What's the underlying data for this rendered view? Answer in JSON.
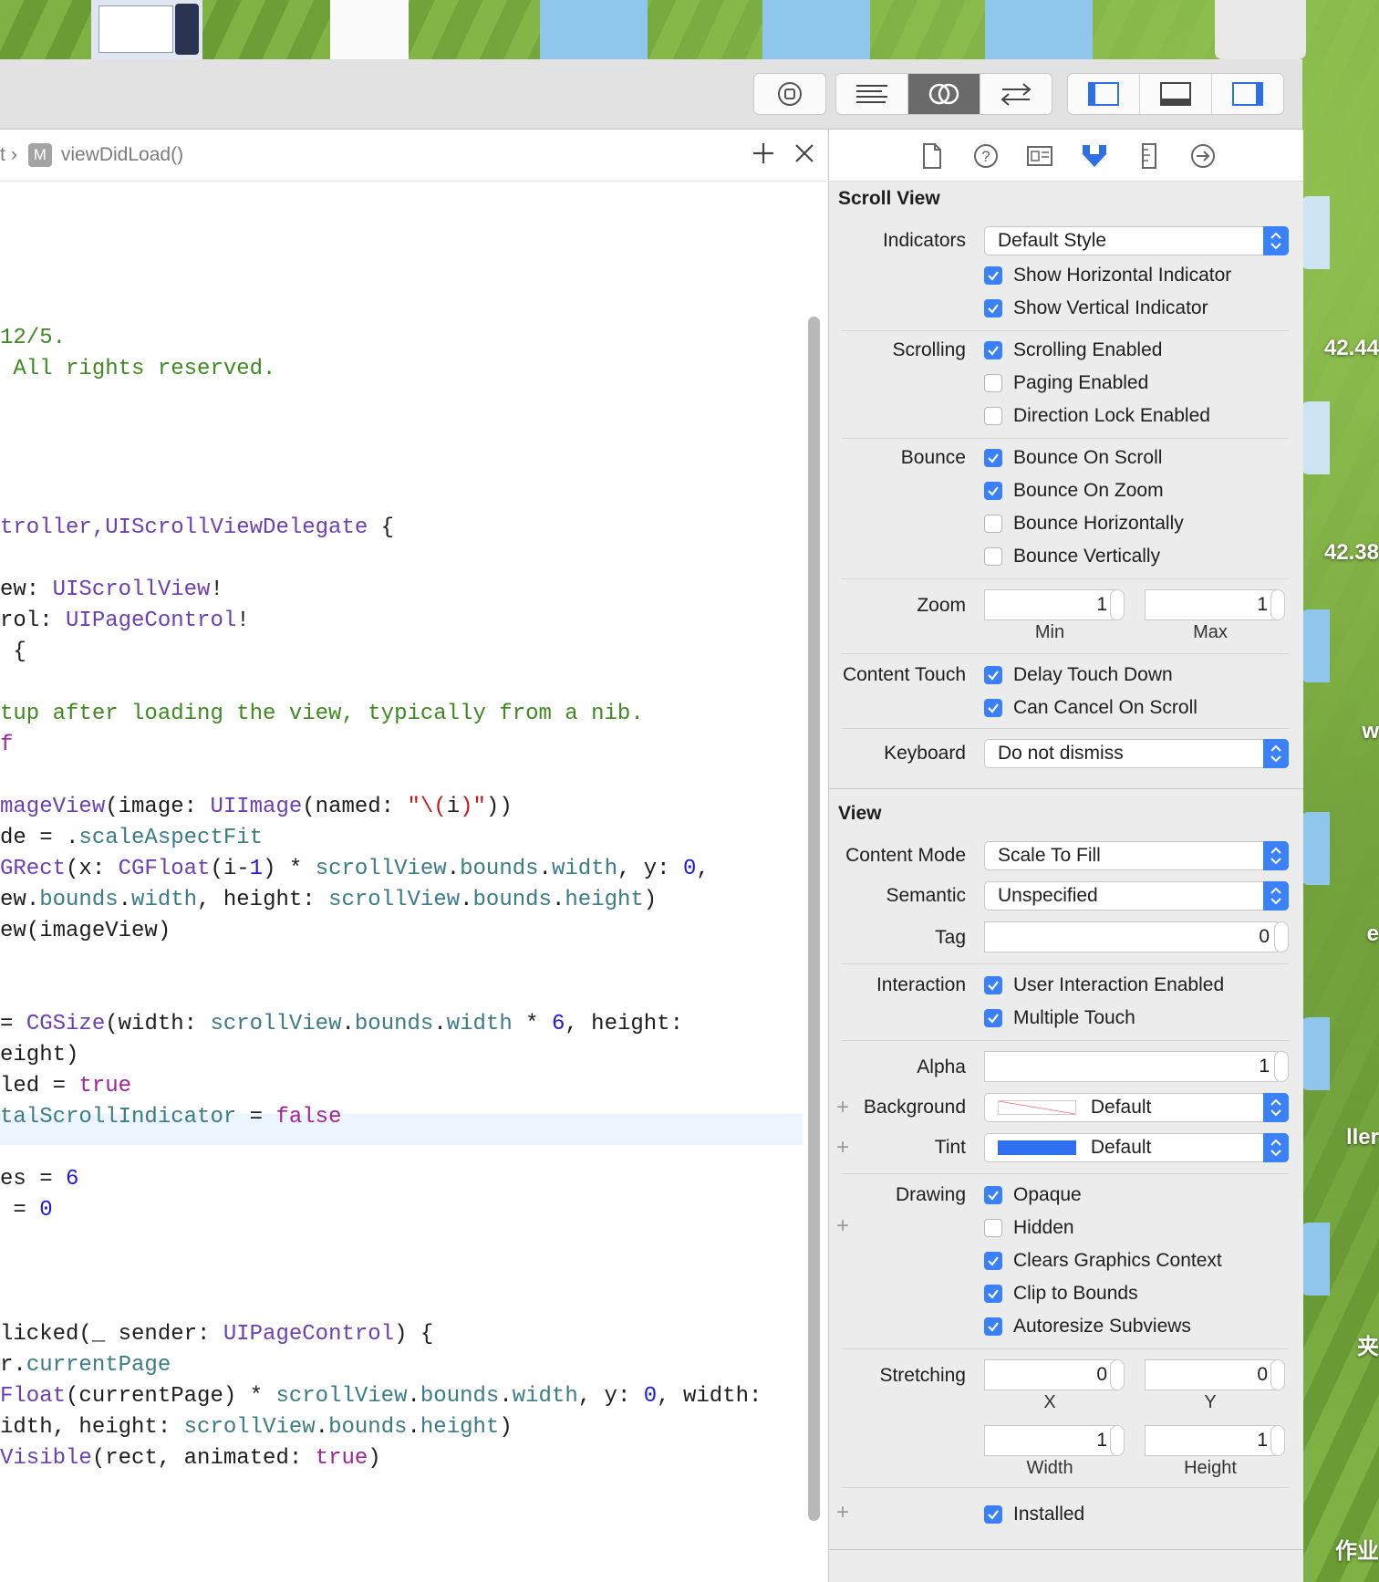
{
  "jumpbar": {
    "truncated_prefix": "t",
    "method_badge": "M",
    "method": "viewDidLoad()"
  },
  "code_lines": [
    [
      [
        "12/5.",
        "c"
      ]
    ],
    [
      [
        " All rights reserved.",
        "c"
      ]
    ],
    [
      [
        "troller,",
        "t"
      ],
      [
        "UIScrollViewDelegate",
        "t"
      ],
      [
        " {",
        ""
      ]
    ],
    [
      [
        "ew: ",
        ""
      ],
      [
        "UIScrollView",
        "t"
      ],
      [
        "!",
        ""
      ]
    ],
    [
      [
        "rol: ",
        ""
      ],
      [
        "UIPageControl",
        "t"
      ],
      [
        "!",
        ""
      ]
    ],
    [
      [
        " {",
        ""
      ]
    ],
    [
      [
        "tup after loading the view, typically from a nib.",
        "c"
      ]
    ],
    [
      [
        "f",
        "k"
      ]
    ],
    [
      [
        "mageView",
        "t"
      ],
      [
        "(image: ",
        ""
      ],
      [
        "UIImage",
        "t"
      ],
      [
        "(named: ",
        ""
      ],
      [
        "\"\\(",
        "s"
      ],
      [
        "i",
        ""
      ],
      [
        ")\"",
        "s"
      ],
      [
        "))",
        ""
      ]
    ],
    [
      [
        "de",
        ""
      ],
      [
        " = .",
        ""
      ],
      [
        "scaleAspectFit",
        "p"
      ]
    ],
    [
      [
        "GRect",
        "t"
      ],
      [
        "(x: ",
        ""
      ],
      [
        "CGFloat",
        "t"
      ],
      [
        "(i-",
        ""
      ],
      [
        "1",
        "n"
      ],
      [
        ") * ",
        ""
      ],
      [
        "scrollView",
        "p"
      ],
      [
        ".",
        ""
      ],
      [
        "bounds",
        "p"
      ],
      [
        ".",
        ""
      ],
      [
        "width",
        "p"
      ],
      [
        ", y: ",
        ""
      ],
      [
        "0",
        "n"
      ],
      [
        ",",
        ""
      ]
    ],
    [
      [
        "ew",
        ""
      ],
      [
        ".",
        ""
      ],
      [
        "bounds",
        "p"
      ],
      [
        ".",
        ""
      ],
      [
        "width",
        "p"
      ],
      [
        ", height: ",
        ""
      ],
      [
        "scrollView",
        "p"
      ],
      [
        ".",
        ""
      ],
      [
        "bounds",
        "p"
      ],
      [
        ".",
        ""
      ],
      [
        "height",
        "p"
      ],
      [
        ")",
        ""
      ]
    ],
    [
      [
        "ew",
        ""
      ],
      [
        "(imageView)",
        ""
      ]
    ],
    [
      [
        "",
        ""
      ]
    ],
    [
      [
        "= ",
        ""
      ],
      [
        "CGSize",
        "t"
      ],
      [
        "(width: ",
        ""
      ],
      [
        "scrollView",
        "p"
      ],
      [
        ".",
        ""
      ],
      [
        "bounds",
        "p"
      ],
      [
        ".",
        ""
      ],
      [
        "width",
        "p"
      ],
      [
        " * ",
        ""
      ],
      [
        "6",
        "n"
      ],
      [
        ", height:",
        ""
      ]
    ],
    [
      [
        "eight",
        ""
      ],
      [
        ")",
        ""
      ]
    ],
    [
      [
        "led",
        ""
      ],
      [
        " = ",
        ""
      ],
      [
        "true",
        "k"
      ]
    ],
    [
      [
        "talScrollIndicator",
        "p"
      ],
      [
        " = ",
        ""
      ],
      [
        "false",
        "k"
      ]
    ],
    [
      [
        "es",
        ""
      ],
      [
        " = ",
        ""
      ],
      [
        "6",
        "n"
      ]
    ],
    [
      [
        " = ",
        ""
      ],
      [
        "0",
        "n"
      ]
    ],
    [
      [
        "licked(_ sender: ",
        ""
      ],
      [
        "UIPageControl",
        "t"
      ],
      [
        ") {",
        ""
      ]
    ],
    [
      [
        "r.",
        ""
      ],
      [
        "currentPage",
        "p"
      ]
    ],
    [
      [
        "Float",
        "t"
      ],
      [
        "(currentPage) * ",
        ""
      ],
      [
        "scrollView",
        "p"
      ],
      [
        ".",
        ""
      ],
      [
        "bounds",
        "p"
      ],
      [
        ".",
        ""
      ],
      [
        "width",
        "p"
      ],
      [
        ", y: ",
        ""
      ],
      [
        "0",
        "n"
      ],
      [
        ", width:",
        ""
      ]
    ],
    [
      [
        "idth",
        ""
      ],
      [
        ", height: ",
        ""
      ],
      [
        "scrollView",
        "p"
      ],
      [
        ".",
        ""
      ],
      [
        "bounds",
        "p"
      ],
      [
        ".",
        ""
      ],
      [
        "height",
        "p"
      ],
      [
        ")",
        ""
      ]
    ],
    [
      [
        "Visible",
        "t"
      ],
      [
        "(rect, animated: ",
        ""
      ],
      [
        "true",
        "k"
      ],
      [
        ")",
        ""
      ]
    ]
  ],
  "inspector": {
    "scroll_view_title": "Scroll View",
    "indicators_label": "Indicators",
    "indicators_value": "Default Style",
    "show_horizontal": "Show Horizontal Indicator",
    "show_vertical": "Show Vertical Indicator",
    "scrolling_label": "Scrolling",
    "scrolling_enabled": "Scrolling Enabled",
    "paging_enabled": "Paging Enabled",
    "direction_lock": "Direction Lock Enabled",
    "bounce_label": "Bounce",
    "bounce_on_scroll": "Bounce On Scroll",
    "bounce_on_zoom": "Bounce On Zoom",
    "bounce_horizontally": "Bounce Horizontally",
    "bounce_vertically": "Bounce Vertically",
    "zoom_label": "Zoom",
    "zoom_min": "1",
    "zoom_max": "1",
    "min_label": "Min",
    "max_label": "Max",
    "content_touch_label": "Content Touch",
    "delay_touch_down": "Delay Touch Down",
    "can_cancel_on_scroll": "Can Cancel On Scroll",
    "keyboard_label": "Keyboard",
    "keyboard_value": "Do not dismiss",
    "view_title": "View",
    "content_mode_label": "Content Mode",
    "content_mode_value": "Scale To Fill",
    "semantic_label": "Semantic",
    "semantic_value": "Unspecified",
    "tag_label": "Tag",
    "tag_value": "0",
    "interaction_label": "Interaction",
    "user_interaction_enabled": "User Interaction Enabled",
    "multiple_touch": "Multiple Touch",
    "alpha_label": "Alpha",
    "alpha_value": "1",
    "background_label": "Background",
    "background_value": "Default",
    "tint_label": "Tint",
    "tint_value": "Default",
    "drawing_label": "Drawing",
    "opaque": "Opaque",
    "hidden": "Hidden",
    "clears_graphics_context": "Clears Graphics Context",
    "clip_to_bounds": "Clip to Bounds",
    "autoresize_subviews": "Autoresize Subviews",
    "stretching_label": "Stretching",
    "stretch_x": "0",
    "stretch_y": "0",
    "stretch_width": "1",
    "stretch_height": "1",
    "x_label": "X",
    "y_label": "Y",
    "width_label": "Width",
    "height_label": "Height",
    "installed": "Installed"
  },
  "desktop": {
    "labels": [
      "42.44",
      "42.38",
      "w",
      "e",
      "ller",
      "夹",
      "作业"
    ]
  },
  "colors": {
    "accent": "#3a80f6",
    "tint_swatch": "#2f6ff0"
  }
}
